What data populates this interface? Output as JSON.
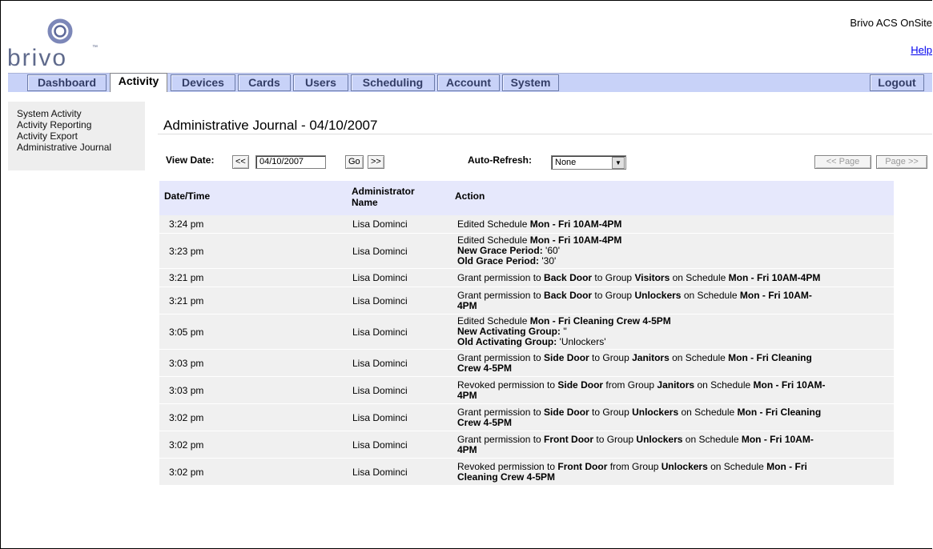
{
  "header": {
    "logo_text": "brivo",
    "logo_tm": "™",
    "product": "Brivo ACS OnSite",
    "help": "Help"
  },
  "tabs": [
    {
      "label": "Dashboard",
      "active": false
    },
    {
      "label": "Activity",
      "active": true
    },
    {
      "label": "Devices",
      "active": false
    },
    {
      "label": "Cards",
      "active": false
    },
    {
      "label": "Users",
      "active": false
    },
    {
      "label": "Scheduling",
      "active": false
    },
    {
      "label": "Account",
      "active": false
    },
    {
      "label": "System",
      "active": false
    }
  ],
  "logout": "Logout",
  "sidebar": {
    "items": [
      "System Activity",
      "Activity Reporting",
      "Activity Export",
      "Administrative Journal"
    ]
  },
  "page": {
    "title": "Administrative Journal - 04/10/2007"
  },
  "controls": {
    "view_date_label": "View Date:",
    "prev": "<<",
    "date_value": "04/10/2007",
    "go": "Go",
    "next": ">>",
    "auto_refresh_label": "Auto-Refresh:",
    "auto_refresh_value": "None",
    "prev_page": "<< Page",
    "next_page": "Page >>"
  },
  "table": {
    "headers": [
      "Date/Time",
      "Administrator Name",
      "Action"
    ],
    "rows": [
      {
        "time": "3:24 pm",
        "admin": "Lisa Dominci",
        "lines": [
          [
            {
              "t": "Edited Schedule "
            },
            {
              "t": "Mon - Fri 10AM-4PM",
              "b": true
            }
          ]
        ]
      },
      {
        "time": "3:23 pm",
        "admin": "Lisa Dominci",
        "lines": [
          [
            {
              "t": "Edited Schedule "
            },
            {
              "t": "Mon - Fri 10AM-4PM",
              "b": true
            }
          ],
          [
            {
              "t": "New Grace Period:",
              "b": true
            },
            {
              "t": " '60'"
            }
          ],
          [
            {
              "t": "Old Grace Period:",
              "b": true
            },
            {
              "t": " '30'"
            }
          ]
        ]
      },
      {
        "time": "3:21 pm",
        "admin": "Lisa Dominci",
        "lines": [
          [
            {
              "t": "Grant permission to "
            },
            {
              "t": "Back Door",
              "b": true
            },
            {
              "t": " to Group "
            },
            {
              "t": "Visitors",
              "b": true
            },
            {
              "t": " on Schedule "
            },
            {
              "t": "Mon - Fri 10AM-4PM",
              "b": true
            }
          ]
        ]
      },
      {
        "time": "3:21 pm",
        "admin": "Lisa Dominci",
        "lines": [
          [
            {
              "t": "Grant permission to "
            },
            {
              "t": "Back Door",
              "b": true
            },
            {
              "t": " to Group "
            },
            {
              "t": "Unlockers",
              "b": true
            },
            {
              "t": " on Schedule "
            },
            {
              "t": "Mon - Fri 10AM-",
              "b": true
            }
          ],
          [
            {
              "t": "4PM",
              "b": true
            }
          ]
        ]
      },
      {
        "time": "3:05 pm",
        "admin": "Lisa Dominci",
        "lines": [
          [
            {
              "t": "Edited Schedule "
            },
            {
              "t": "Mon - Fri Cleaning Crew 4-5PM",
              "b": true
            }
          ],
          [
            {
              "t": "New Activating Group:",
              "b": true
            },
            {
              "t": " ''"
            }
          ],
          [
            {
              "t": "Old Activating Group:",
              "b": true
            },
            {
              "t": " 'Unlockers'"
            }
          ]
        ]
      },
      {
        "time": "3:03 pm",
        "admin": "Lisa Dominci",
        "lines": [
          [
            {
              "t": "Grant permission to "
            },
            {
              "t": "Side Door",
              "b": true
            },
            {
              "t": " to Group "
            },
            {
              "t": "Janitors",
              "b": true
            },
            {
              "t": " on Schedule "
            },
            {
              "t": "Mon - Fri Cleaning",
              "b": true
            }
          ],
          [
            {
              "t": "Crew 4-5PM",
              "b": true
            }
          ]
        ]
      },
      {
        "time": "3:03 pm",
        "admin": "Lisa Dominci",
        "lines": [
          [
            {
              "t": "Revoked permission to "
            },
            {
              "t": "Side Door",
              "b": true
            },
            {
              "t": " from Group "
            },
            {
              "t": "Janitors",
              "b": true
            },
            {
              "t": " on Schedule "
            },
            {
              "t": "Mon - Fri 10AM-",
              "b": true
            }
          ],
          [
            {
              "t": "4PM",
              "b": true
            }
          ]
        ]
      },
      {
        "time": "3:02 pm",
        "admin": "Lisa Dominci",
        "lines": [
          [
            {
              "t": "Grant permission to "
            },
            {
              "t": "Side Door",
              "b": true
            },
            {
              "t": " to Group "
            },
            {
              "t": "Unlockers",
              "b": true
            },
            {
              "t": " on Schedule "
            },
            {
              "t": "Mon - Fri Cleaning",
              "b": true
            }
          ],
          [
            {
              "t": "Crew 4-5PM",
              "b": true
            }
          ]
        ]
      },
      {
        "time": "3:02 pm",
        "admin": "Lisa Dominci",
        "lines": [
          [
            {
              "t": "Grant permission to "
            },
            {
              "t": "Front Door",
              "b": true
            },
            {
              "t": " to Group "
            },
            {
              "t": "Unlockers",
              "b": true
            },
            {
              "t": " on Schedule "
            },
            {
              "t": "Mon - Fri 10AM-",
              "b": true
            }
          ],
          [
            {
              "t": "4PM",
              "b": true
            }
          ]
        ]
      },
      {
        "time": "3:02 pm",
        "admin": "Lisa Dominci",
        "lines": [
          [
            {
              "t": "Revoked permission to "
            },
            {
              "t": "Front Door",
              "b": true
            },
            {
              "t": " from Group "
            },
            {
              "t": "Unlockers",
              "b": true
            },
            {
              "t": " on Schedule "
            },
            {
              "t": "Mon - Fri",
              "b": true
            }
          ],
          [
            {
              "t": "Cleaning Crew 4-5PM",
              "b": true
            }
          ]
        ]
      }
    ]
  }
}
